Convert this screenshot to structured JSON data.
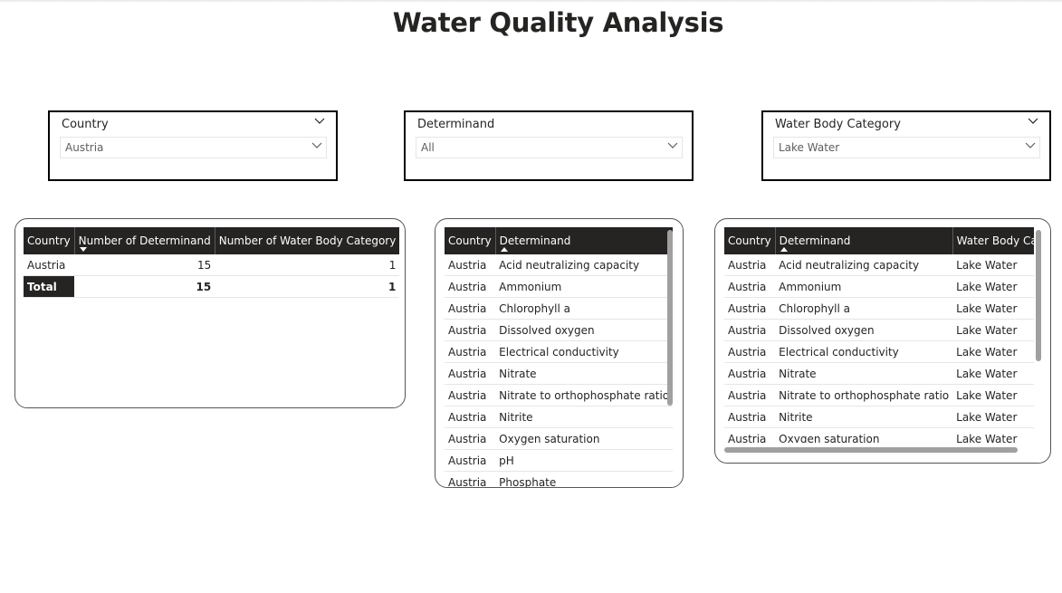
{
  "page": {
    "title": "Water Quality Analysis"
  },
  "slicers": [
    {
      "label": "Country",
      "value": "Austria"
    },
    {
      "label": "Determinand",
      "value": "All"
    },
    {
      "label": "Water Body Category",
      "value": "Lake Water"
    }
  ],
  "summary_table": {
    "headers": [
      "Country",
      "Number of Determinand",
      "Number of Water Body Category"
    ],
    "rows": [
      [
        "Austria",
        "15",
        "1"
      ]
    ],
    "total": [
      "Total",
      "15",
      "1"
    ]
  },
  "determinand_table": {
    "headers": [
      "Country",
      "Determinand"
    ],
    "rows": [
      [
        "Austria",
        "Acid neutralizing capacity"
      ],
      [
        "Austria",
        "Ammonium"
      ],
      [
        "Austria",
        "Chlorophyll a"
      ],
      [
        "Austria",
        "Dissolved oxygen"
      ],
      [
        "Austria",
        "Electrical conductivity"
      ],
      [
        "Austria",
        "Nitrate"
      ],
      [
        "Austria",
        "Nitrate to orthophosphate ratio"
      ],
      [
        "Austria",
        "Nitrite"
      ],
      [
        "Austria",
        "Oxygen saturation"
      ],
      [
        "Austria",
        "pH"
      ],
      [
        "Austria",
        "Phosphate"
      ]
    ]
  },
  "category_table": {
    "headers": [
      "Country",
      "Determinand",
      "Water Body Category"
    ],
    "rows": [
      [
        "Austria",
        "Acid neutralizing capacity",
        "Lake Water"
      ],
      [
        "Austria",
        "Ammonium",
        "Lake Water"
      ],
      [
        "Austria",
        "Chlorophyll a",
        "Lake Water"
      ],
      [
        "Austria",
        "Dissolved oxygen",
        "Lake Water"
      ],
      [
        "Austria",
        "Electrical conductivity",
        "Lake Water"
      ],
      [
        "Austria",
        "Nitrate",
        "Lake Water"
      ],
      [
        "Austria",
        "Nitrate to orthophosphate ratio",
        "Lake Water"
      ],
      [
        "Austria",
        "Nitrite",
        "Lake Water"
      ],
      [
        "Austria",
        "Oxygen saturation",
        "Lake Water"
      ]
    ]
  },
  "icons": {
    "dropdown": "chevron-down-icon",
    "sort_desc": "sort-descending-icon",
    "sort_asc": "sort-ascending-icon"
  }
}
